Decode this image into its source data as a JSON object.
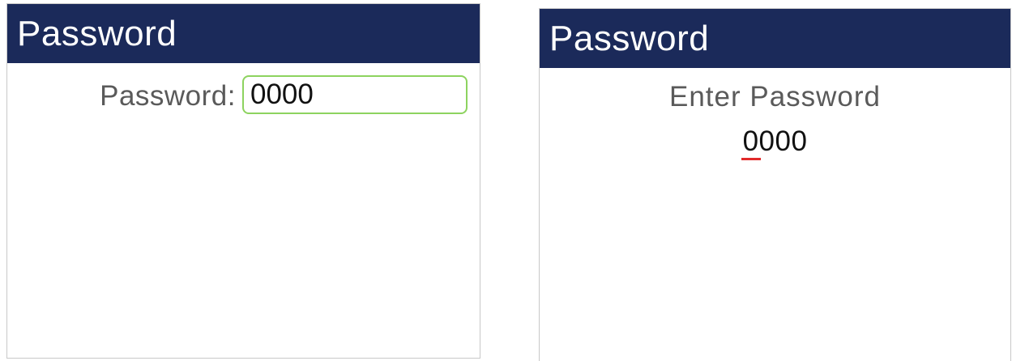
{
  "left_screen": {
    "title": "Password",
    "label": "Password:",
    "input_value": "0000",
    "input_border_color": "#8dd35f"
  },
  "right_screen": {
    "title": "Password",
    "prompt": "Enter Password",
    "entry_first_char": "0",
    "entry_rest": "000",
    "cursor_color": "#e12a2a"
  },
  "colors": {
    "title_bar": "#1b2a5a",
    "title_text": "#ffffff",
    "label_text": "#5a5a5a"
  }
}
